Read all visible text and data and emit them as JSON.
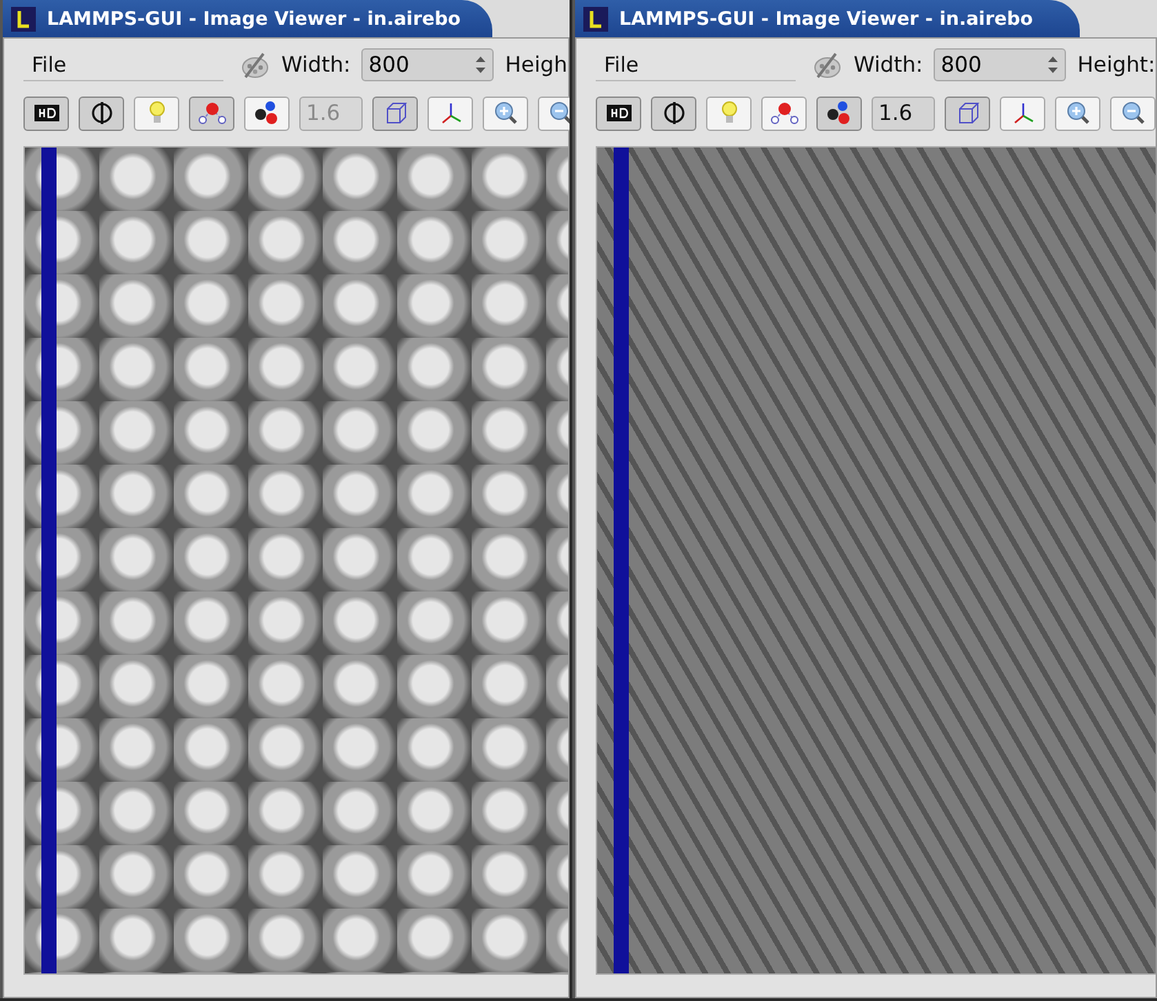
{
  "windows": [
    {
      "title": "LAMMPS-GUI - Image Viewer - in.airebo",
      "menu": [
        {
          "label": "File"
        }
      ],
      "width_label": "Width:",
      "width_value": "800",
      "height_label": "Heigh",
      "kind": "spheres",
      "toolbar": [
        {
          "kind": "hd",
          "checked": true
        },
        {
          "kind": "ortho",
          "checked": true
        },
        {
          "kind": "light",
          "checked": false
        },
        {
          "kind": "vdw",
          "checked": true
        },
        {
          "kind": "cpk",
          "checked": false
        },
        {
          "kind": "field",
          "value": "1.6",
          "disabled": true
        },
        {
          "kind": "box",
          "checked": true
        },
        {
          "kind": "axes",
          "checked": false
        },
        {
          "kind": "zoomin",
          "checked": false
        },
        {
          "kind": "zoomout",
          "checked": false
        }
      ]
    },
    {
      "title": "LAMMPS-GUI - Image Viewer - in.airebo",
      "menu": [
        {
          "label": "File"
        }
      ],
      "width_label": "Width:",
      "width_value": "800",
      "height_label": "Height:",
      "kind": "sticks",
      "toolbar": [
        {
          "kind": "hd",
          "checked": true
        },
        {
          "kind": "ortho",
          "checked": true
        },
        {
          "kind": "light",
          "checked": false
        },
        {
          "kind": "vdw",
          "checked": false
        },
        {
          "kind": "cpk",
          "checked": true
        },
        {
          "kind": "field",
          "value": "1.6",
          "disabled": false
        },
        {
          "kind": "box",
          "checked": true
        },
        {
          "kind": "axes",
          "checked": false
        },
        {
          "kind": "zoomin",
          "checked": false
        },
        {
          "kind": "zoomout",
          "checked": false
        }
      ]
    }
  ]
}
